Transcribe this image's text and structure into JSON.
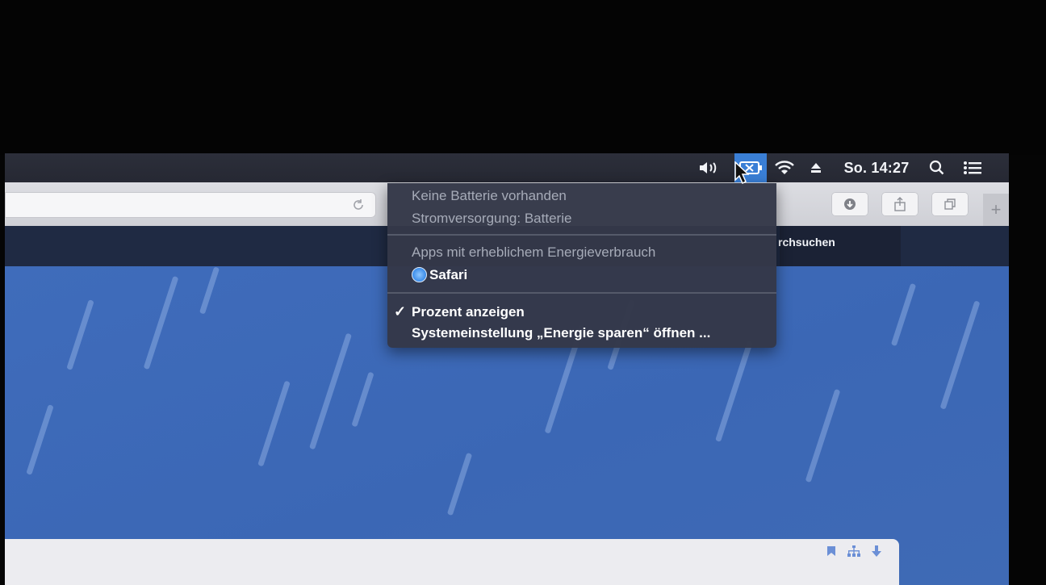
{
  "menubar": {
    "clock": "So. 14:27",
    "icons": [
      "volume-icon",
      "battery-icon",
      "wifi-icon",
      "eject-icon",
      "spotlight-icon",
      "notification-center-icon"
    ]
  },
  "toolbar": {
    "url_value": "",
    "buttons": [
      "download-icon",
      "share-icon",
      "tabs-overview-icon"
    ],
    "new_tab_label": "+"
  },
  "bookmarks_bar": {
    "partial_text": "rchsuchen"
  },
  "battery_menu": {
    "status_lines": [
      "Keine Batterie vorhanden",
      "Stromversorgung: Batterie"
    ],
    "apps_header": "Apps mit erheblichem Energieverbrauch",
    "apps": [
      {
        "name": "Safari",
        "icon": "safari-icon"
      }
    ],
    "check_mark": "✓",
    "actions": [
      {
        "label": "Prozent anzeigen",
        "checked": true
      },
      {
        "label": "Systemeinstellung „Energie sparen“ öffnen ...",
        "checked": false
      }
    ]
  },
  "colors": {
    "menubar": "#2a2d38",
    "battery_highlight": "#3a7fd6",
    "menu_background": "#343848",
    "page_blue": "#3b67b5"
  }
}
